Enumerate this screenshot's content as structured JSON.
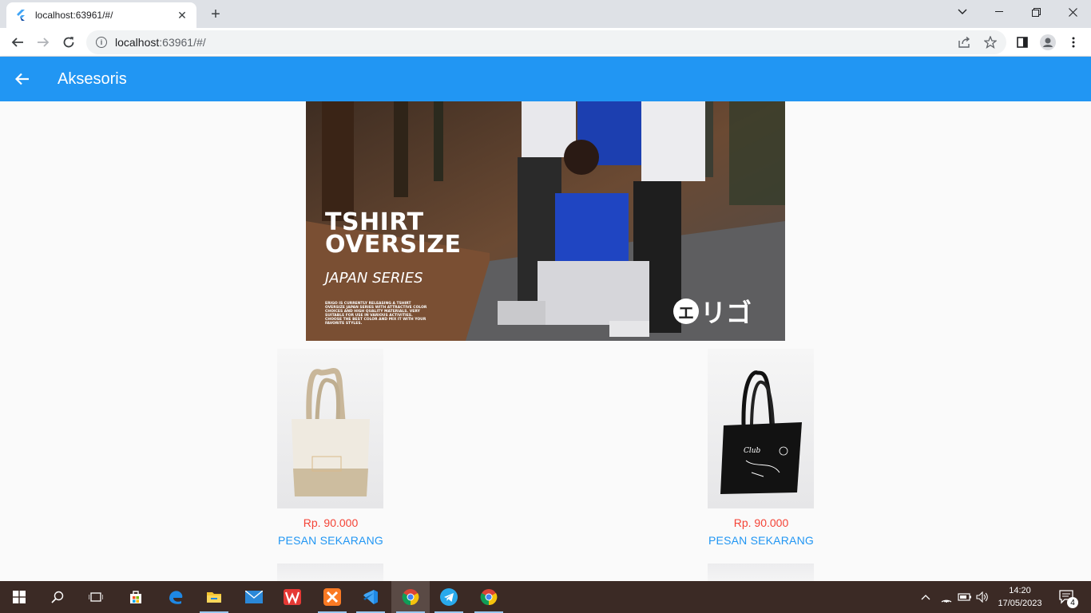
{
  "browser": {
    "tab_title": "localhost:63961/#/",
    "url_host": "localhost",
    "url_rest": ":63961/#/"
  },
  "appbar": {
    "title": "Aksesoris"
  },
  "banner": {
    "headline_line1": "TSHIRT",
    "headline_line2": "OVERSIZE",
    "series": "JAPAN SERIES",
    "copy": "ERIGO IS CURRENTLY RELEASING A TSHIRT OVERSIZE JAPAN SERIES WITH ATTRACTIVE COLOR CHOICES AND HIGH QUALITY MATERIALS. VERY SUITABLE FOR USE IN VARIOUS ACTIVITIES. CHOOSE THE BEST COLOR AND MIX IT WITH YOUR FAVORITE STYLES.",
    "brand_circle": "エ",
    "brand_text": "リゴ"
  },
  "products": [
    {
      "price": "Rp. 90.000",
      "action": "PESAN SEKARANG",
      "bag": "natural-tote"
    },
    {
      "price": "Rp. 90.000",
      "action": "PESAN SEKARANG",
      "bag": "black-tote"
    }
  ],
  "taskbar": {
    "time": "14:20",
    "date": "17/05/2023",
    "notification_count": "4"
  },
  "colors": {
    "appbar": "#2196f3",
    "price": "#f44336",
    "action": "#2196f3"
  }
}
